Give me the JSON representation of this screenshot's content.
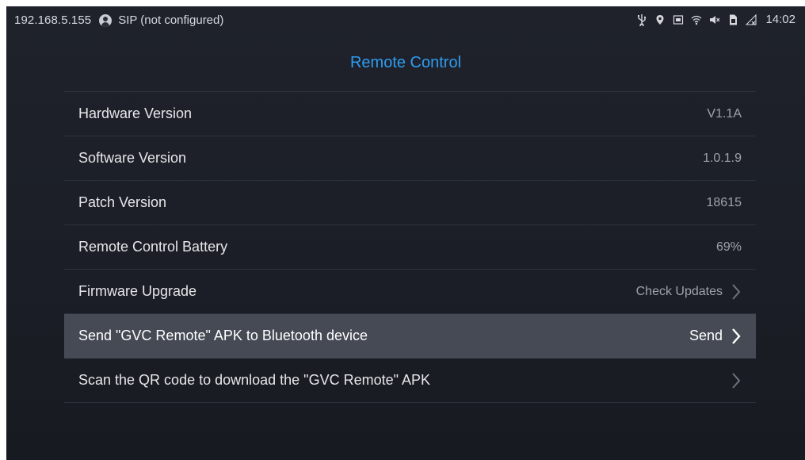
{
  "statusbar": {
    "ip": "192.168.5.155",
    "account": "SIP (not configured)",
    "icons": [
      "usb-icon",
      "location-icon",
      "screen-icon",
      "wifi-icon",
      "mute-icon",
      "sim-icon",
      "no-signal-icon"
    ],
    "time": "14:02"
  },
  "page": {
    "title": "Remote Control"
  },
  "items": [
    {
      "label": "Hardware Version",
      "value": "V1.1A"
    },
    {
      "label": "Software Version",
      "value": "1.0.1.9"
    },
    {
      "label": "Patch Version",
      "value": "18615"
    },
    {
      "label": "Remote Control Battery",
      "value": "69%"
    },
    {
      "label": "Firmware Upgrade",
      "value": "Check Updates"
    },
    {
      "label": "Send \"GVC Remote\" APK to Bluetooth device",
      "value": "Send"
    },
    {
      "label": "Scan the QR code to download the \"GVC Remote\" APK",
      "value": ""
    }
  ],
  "colors": {
    "accent": "#2f9cf0",
    "background": "#1d2028",
    "selected_row": "#454a55"
  }
}
